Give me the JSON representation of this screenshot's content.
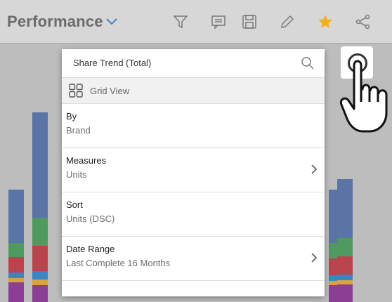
{
  "header": {
    "title": "Performance",
    "icons": [
      "chevron-down-icon",
      "filter-icon",
      "comment-icon",
      "save-icon",
      "edit-icon",
      "star-icon",
      "share-icon"
    ],
    "star_color": "#f2b01e"
  },
  "panel": {
    "title": "Share Trend (Total)",
    "grid_view_label": "Grid View",
    "items": [
      {
        "label": "By",
        "value": "Brand",
        "has_arrow": false
      },
      {
        "label": "Measures",
        "value": "Units",
        "has_arrow": true
      },
      {
        "label": "Sort",
        "value": "Units (DSC)",
        "has_arrow": false
      },
      {
        "label": "Date Range",
        "value": "Last Complete 16 Months",
        "has_arrow": true
      }
    ]
  },
  "colors": {
    "series": [
      "#4a6fb0",
      "#3f9a52",
      "#c83b45",
      "#3a86c2",
      "#e3a32b",
      "#8a3f94",
      "#2f9d8a"
    ]
  }
}
